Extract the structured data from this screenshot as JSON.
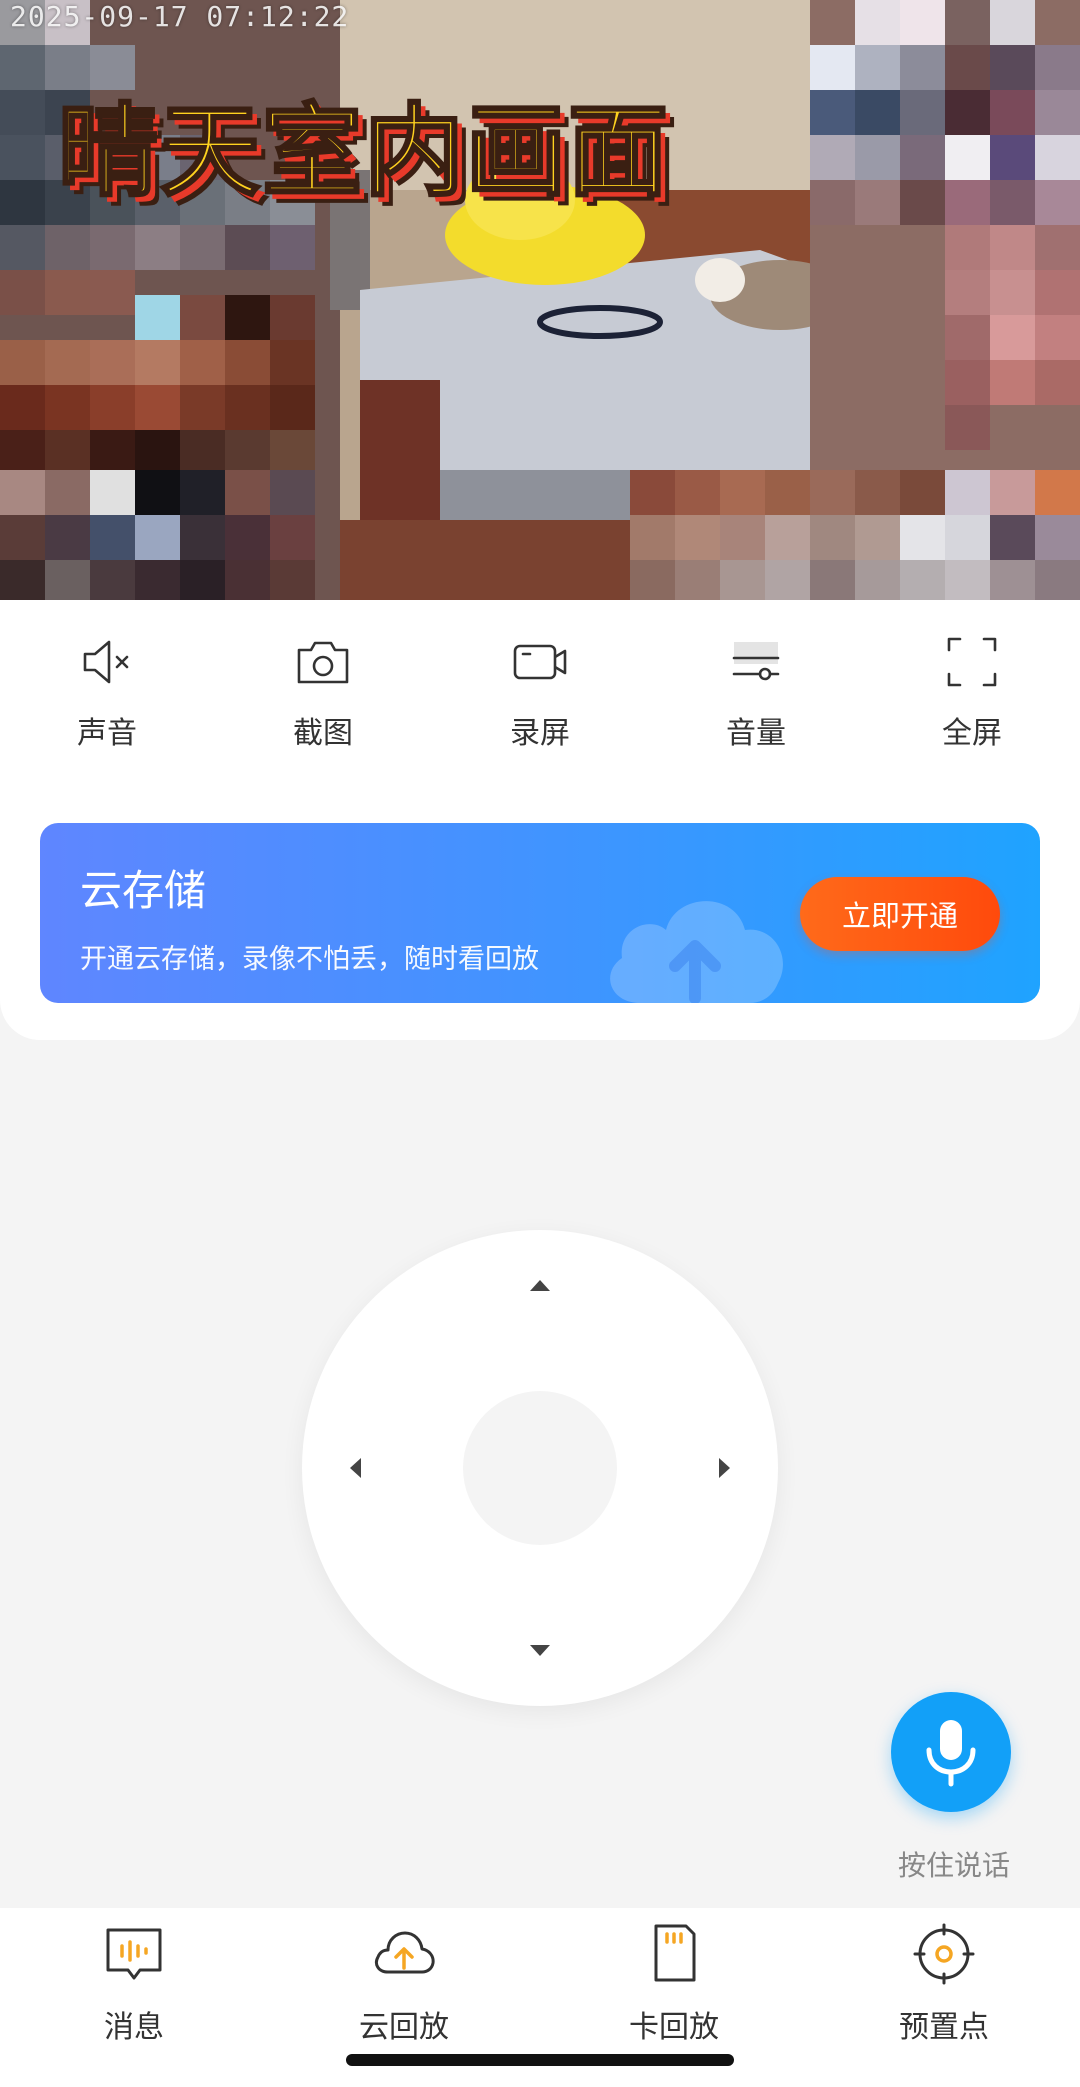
{
  "video": {
    "timestamp": "2025-09-17  07:12:22",
    "overlay_title": "晴天室内画面"
  },
  "controls": [
    {
      "id": "sound",
      "label": "声音",
      "icon": "speaker-muted-icon"
    },
    {
      "id": "screenshot",
      "label": "截图",
      "icon": "camera-icon"
    },
    {
      "id": "record",
      "label": "录屏",
      "icon": "video-record-icon"
    },
    {
      "id": "volume",
      "label": "音量",
      "icon": "volume-slider-icon"
    },
    {
      "id": "fullscreen",
      "label": "全屏",
      "icon": "fullscreen-icon"
    }
  ],
  "cloud_banner": {
    "title": "云存储",
    "description": "开通云存储，录像不怕丢，随时看回放",
    "button_label": "立即开通"
  },
  "talk": {
    "label": "按住说话",
    "icon": "microphone-icon"
  },
  "tabs": [
    {
      "id": "messages",
      "label": "消息",
      "icon": "message-icon"
    },
    {
      "id": "cloud_playback",
      "label": "云回放",
      "icon": "cloud-upload-icon"
    },
    {
      "id": "card_playback",
      "label": "卡回放",
      "icon": "sd-card-icon"
    },
    {
      "id": "presets",
      "label": "预置点",
      "icon": "target-icon"
    }
  ],
  "colors": {
    "accent_blue": "#12a0f8",
    "tab_icon_orange": "#f5a623",
    "cta_orange": "#ff5a14",
    "banner_start": "#5f86ff",
    "banner_end": "#1fa3ff"
  }
}
